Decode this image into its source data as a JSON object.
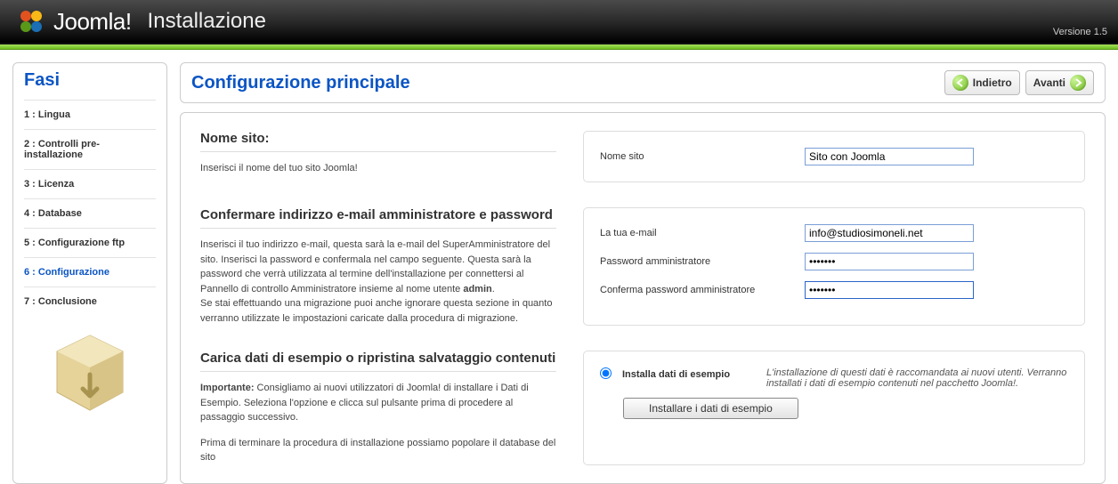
{
  "header": {
    "brand": "Joomla!",
    "title": "Installazione",
    "version": "Versione 1.5"
  },
  "sidebar": {
    "title": "Fasi",
    "steps": [
      "1 : Lingua",
      "2 : Controlli pre-installazione",
      "3 : Licenza",
      "4 : Database",
      "5 : Configurazione ftp",
      "6 : Configurazione",
      "7 : Conclusione"
    ],
    "active_index": 5
  },
  "nav": {
    "back": "Indietro",
    "next": "Avanti"
  },
  "page_title": "Configurazione principale",
  "section_site": {
    "heading": "Nome sito:",
    "hint": "Inserisci il nome del tuo sito Joomla!",
    "field_label": "Nome sito",
    "field_value": "Sito con Joomla"
  },
  "section_admin": {
    "heading": "Confermare indirizzo e-mail amministratore e password",
    "hint_pre": "Inserisci il tuo indirizzo e-mail, questa sarà la e-mail del SuperAmministratore del sito. Inserisci la password e confermala nel campo seguente. Questa sarà la password che verrà utilizzata al termine dell'installazione per connettersi al Pannello di controllo Amministratore insieme al nome utente ",
    "hint_bold": "admin",
    "hint_post": ".\nSe stai effettuando una migrazione puoi anche ignorare questa sezione in quanto verranno utilizzate le impostazioni caricate dalla procedura di migrazione.",
    "email_label": "La tua e-mail",
    "email_value": "info@studiosimoneli.net",
    "pass_label": "Password amministratore",
    "pass_value": "•••••••",
    "pass2_label": "Conferma password amministratore",
    "pass2_value": "•••••••"
  },
  "section_sample": {
    "heading": "Carica dati di esempio o ripristina salvataggio contenuti",
    "hint_bold": "Importante:",
    "hint_rest": " Consigliamo ai nuovi utilizzatori di Joomla! di installare i Dati di Esempio. Seleziona l'opzione e clicca sul pulsante prima di procedere al passaggio successivo.",
    "hint2": "Prima di terminare la procedura di installazione possiamo popolare il database del sito",
    "radio_label": "Installa dati di esempio",
    "radio_desc": "L'installazione di questi dati è raccomandata ai nuovi utenti. Verranno installati i dati di esempio contenuti nel pacchetto Joomla!.",
    "button": "Installare i dati di esempio"
  }
}
